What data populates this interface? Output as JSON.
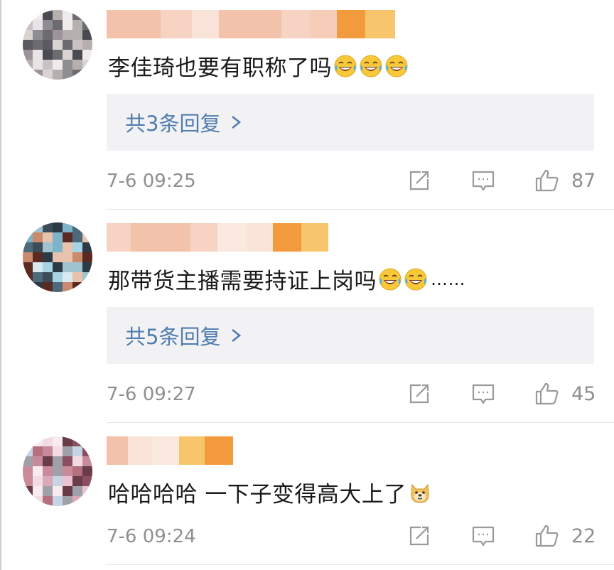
{
  "comments": [
    {
      "text": "李佳琦也要有职称了吗",
      "emoji": [
        "laugh-cry-icon",
        "laugh-cry-icon",
        "laugh-cry-icon"
      ],
      "suffix": "",
      "reply_label": "共3条回复",
      "timestamp": "7-6 09:25",
      "likes": "87"
    },
    {
      "text": "那带货主播需要持证上岗吗",
      "emoji": [
        "laugh-cry-icon",
        "laugh-cry-icon"
      ],
      "suffix": "……",
      "reply_label": "共5条回复",
      "timestamp": "7-6 09:27",
      "likes": "45"
    },
    {
      "text": "哈哈哈哈 一下子变得高大上了",
      "emoji": [
        "doge-icon"
      ],
      "suffix": "",
      "reply_label": "",
      "timestamp": "7-6 09:24",
      "likes": "22"
    }
  ],
  "colors": {
    "link": "#507daf",
    "meta": "#8f8f8f",
    "reply_bg": "#f2f2f4"
  }
}
